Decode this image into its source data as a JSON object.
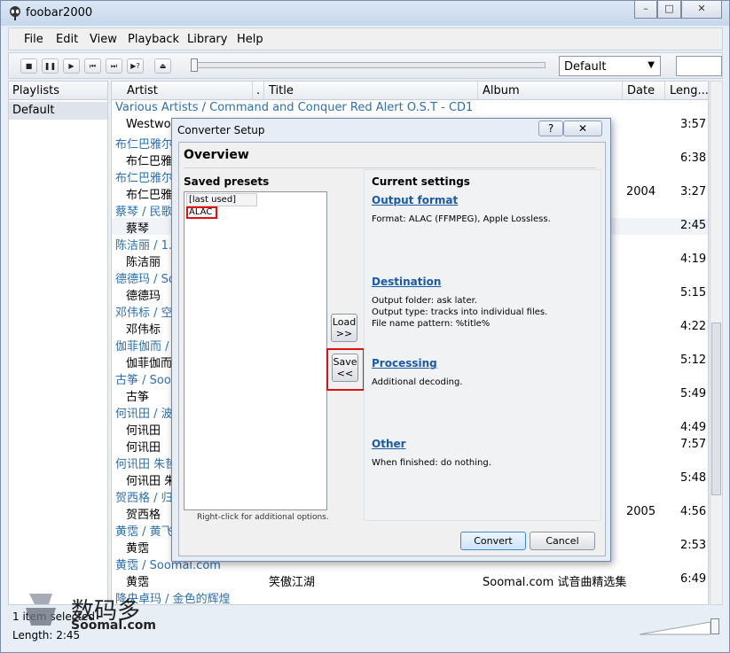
{
  "window": {
    "title": "foobar2000",
    "min": "–",
    "max": "□",
    "close": "✕"
  },
  "menu": [
    "File",
    "Edit",
    "View",
    "Playback",
    "Library",
    "Help"
  ],
  "toolbar": {
    "dsp": "Default"
  },
  "playlists": {
    "header": "Playlists",
    "items": [
      "Default"
    ]
  },
  "columns": [
    "Artist",
    ".",
    "Title",
    "Album",
    "Date",
    "Leng..."
  ],
  "rows": [
    {
      "group": true,
      "artist": "Various Artists / Command and Conquer Red Alert O.S.T - CD1"
    },
    {
      "artist": "Westwoo",
      "date": "",
      "length": "3:57"
    },
    {
      "group": true,
      "artist": "布仁巴雅尔"
    },
    {
      "artist": "布仁巴雅尔",
      "date": "",
      "length": "6:38"
    },
    {
      "group": true,
      "artist": "布仁巴雅尔"
    },
    {
      "artist": "布仁巴雅尔",
      "date": "2004",
      "length": "3:27"
    },
    {
      "group": true,
      "artist": "蔡琴 / 民歌"
    },
    {
      "artist": "蔡琴",
      "date": "",
      "length": "2:45",
      "alt": true
    },
    {
      "group": true,
      "artist": "陈洁丽 / 1.8"
    },
    {
      "artist": "陈洁丽",
      "date": "",
      "length": "4:19"
    },
    {
      "group": true,
      "artist": "德德玛 / So"
    },
    {
      "artist": "德德玛",
      "date": "",
      "length": "5:15"
    },
    {
      "group": true,
      "artist": "邓伟标 / 空"
    },
    {
      "artist": "邓伟标",
      "date": "",
      "length": "4:22"
    },
    {
      "group": true,
      "artist": "伽菲伽而 / "
    },
    {
      "artist": "伽菲伽而",
      "date": "",
      "length": "5:12"
    },
    {
      "group": true,
      "artist": "古筝 / Soor"
    },
    {
      "artist": "古筝",
      "date": "",
      "length": "5:49"
    },
    {
      "group": true,
      "artist": "何讯田 / 波"
    },
    {
      "artist": "何讯田",
      "date": "",
      "length": "4:49"
    },
    {
      "artist": "何讯田",
      "date": "",
      "length": "7:57"
    },
    {
      "group": true,
      "artist": "何讯田 朱哲"
    },
    {
      "artist": "何讯田 朱",
      "date": "",
      "length": "5:48"
    },
    {
      "group": true,
      "artist": "贺西格 / 归"
    },
    {
      "artist": "贺西格",
      "date": "2005",
      "length": "4:56"
    },
    {
      "group": true,
      "artist": "黄霑 / 黄飞鸿"
    },
    {
      "artist": "黄霑",
      "date": "",
      "length": "2:53"
    },
    {
      "group": true,
      "artist": "黄霑 / Soomal.com"
    },
    {
      "artist": "黄霑",
      "title": "笑傲江湖",
      "album": "Soomal.com 试音曲精选集",
      "date": "",
      "length": "6:49"
    },
    {
      "group": true,
      "artist": "降央卓玛 / 金色的辉煌"
    }
  ],
  "status": {
    "line1": "1 item selected",
    "line2": "Length: 2:45"
  },
  "watermark": {
    "cn": "数码多",
    "en": "Soomal.com"
  },
  "dialog": {
    "title": "Converter Setup",
    "help": "?",
    "close": "✕",
    "overview": "Overview",
    "saved_presets": "Saved presets",
    "presets": [
      "[last used]",
      "ALAC"
    ],
    "hint": "Right-click for additional options.",
    "load": "Load",
    "load_arrow": ">>",
    "save": "Save",
    "save_arrow": "<<",
    "current_settings": "Current settings",
    "output_format": {
      "label": "Output format",
      "lines": [
        "Format: ALAC (FFMPEG), Apple Lossless."
      ]
    },
    "destination": {
      "label": "Destination",
      "lines": [
        "Output folder: ask later.",
        "Output type: tracks into individual files.",
        "File name pattern: %title%"
      ]
    },
    "processing": {
      "label": "Processing",
      "lines": [
        "Additional decoding."
      ]
    },
    "other": {
      "label": "Other",
      "lines": [
        "When finished: do nothing."
      ]
    },
    "convert": "Convert",
    "cancel": "Cancel"
  }
}
